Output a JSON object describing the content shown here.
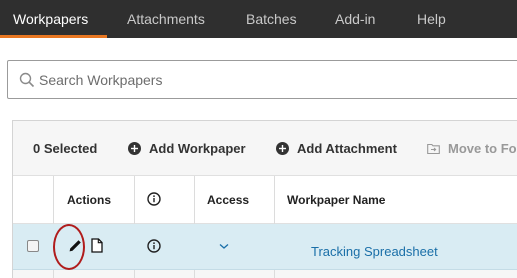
{
  "topnav": {
    "tabs": [
      {
        "label": "Workpapers",
        "active": true
      },
      {
        "label": "Attachments",
        "active": false
      },
      {
        "label": "Batches",
        "active": false
      },
      {
        "label": "Add-in",
        "active": false
      },
      {
        "label": "Help",
        "active": false
      }
    ],
    "active_color": "#e87722"
  },
  "search": {
    "icon": "search-icon",
    "placeholder": "Search Workpapers"
  },
  "toolbar": {
    "selected_count": "0 Selected",
    "add_workpaper": "Add Workpaper",
    "add_attachment": "Add Attachment",
    "move_to": "Move to Fo"
  },
  "table": {
    "headers": {
      "actions": "Actions",
      "info_icon": "info-icon",
      "access": "Access",
      "workpaper_name": "Workpaper Name"
    },
    "rows": [
      {
        "selected": false,
        "actions": [
          "pencil-edit-icon",
          "document-icon"
        ],
        "info": "info-icon",
        "access": "chevron-down-icon",
        "workpaper_name": "Tracking Spreadsheet"
      }
    ],
    "row_highlight_color": "#d9ecf3"
  }
}
